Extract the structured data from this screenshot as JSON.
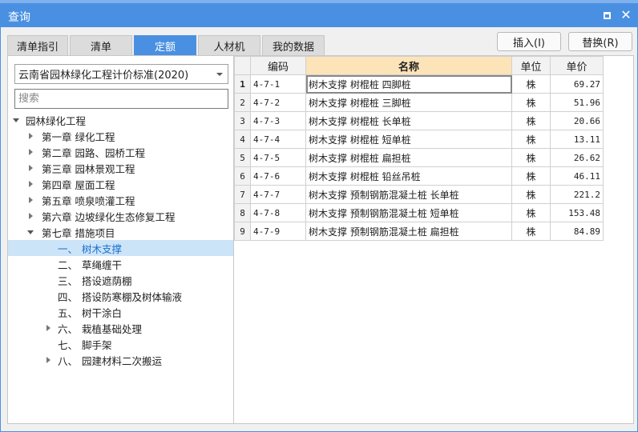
{
  "window": {
    "title": "查询"
  },
  "tabs": [
    {
      "label": "清单指引",
      "active": false
    },
    {
      "label": "清单",
      "active": false
    },
    {
      "label": "定额",
      "active": true
    },
    {
      "label": "人材机",
      "active": false
    },
    {
      "label": "我的数据",
      "active": false
    }
  ],
  "toolbar": {
    "insert_label": "插入(I)",
    "replace_label": "替换(R)"
  },
  "library": {
    "selected": "云南省园林绿化工程计价标准(2020)"
  },
  "search": {
    "placeholder": "搜索",
    "value": ""
  },
  "tree": [
    {
      "label": "园林绿化工程",
      "level": 0,
      "state": "expanded"
    },
    {
      "label": "第一章 绿化工程",
      "level": 1,
      "state": "collapsed"
    },
    {
      "label": "第二章 园路、园桥工程",
      "level": 1,
      "state": "collapsed"
    },
    {
      "label": "第三章 园林景观工程",
      "level": 1,
      "state": "collapsed"
    },
    {
      "label": "第四章 屋面工程",
      "level": 1,
      "state": "collapsed"
    },
    {
      "label": "第五章 喷泉喷灌工程",
      "level": 1,
      "state": "collapsed"
    },
    {
      "label": "第六章 边坡绿化生态修复工程",
      "level": 1,
      "state": "collapsed"
    },
    {
      "label": "第七章 措施项目",
      "level": 1,
      "state": "expanded"
    },
    {
      "num": "一、",
      "label": "树木支撑",
      "level": 2,
      "state": "leaf",
      "selected": true
    },
    {
      "num": "二、",
      "label": "草绳缠干",
      "level": 2,
      "state": "leaf"
    },
    {
      "num": "三、",
      "label": "搭设遮荫棚",
      "level": 2,
      "state": "leaf"
    },
    {
      "num": "四、",
      "label": "搭设防寒棚及树体输液",
      "level": 2,
      "state": "leaf"
    },
    {
      "num": "五、",
      "label": "树干涂白",
      "level": 2,
      "state": "leaf"
    },
    {
      "num": "六、",
      "label": "栽植基础处理",
      "level": 2,
      "state": "collapsed"
    },
    {
      "num": "七、",
      "label": "脚手架",
      "level": 2,
      "state": "leaf"
    },
    {
      "num": "八、",
      "label": "园建材料二次搬运",
      "level": 2,
      "state": "collapsed"
    }
  ],
  "grid": {
    "headers": {
      "code": "编码",
      "name": "名称",
      "unit": "单位",
      "price": "单价"
    },
    "rows": [
      {
        "n": "1",
        "code": "4-7-1",
        "name": "树木支撑 树棍桩 四脚桩",
        "unit": "株",
        "price": "69.27"
      },
      {
        "n": "2",
        "code": "4-7-2",
        "name": "树木支撑 树棍桩 三脚桩",
        "unit": "株",
        "price": "51.96"
      },
      {
        "n": "3",
        "code": "4-7-3",
        "name": "树木支撑 树棍桩 长单桩",
        "unit": "株",
        "price": "20.66"
      },
      {
        "n": "4",
        "code": "4-7-4",
        "name": "树木支撑 树棍桩 短单桩",
        "unit": "株",
        "price": "13.11"
      },
      {
        "n": "5",
        "code": "4-7-5",
        "name": "树木支撑 树棍桩 扁担桩",
        "unit": "株",
        "price": "26.62"
      },
      {
        "n": "6",
        "code": "4-7-6",
        "name": "树木支撑 树棍桩 铅丝吊桩",
        "unit": "株",
        "price": "46.11"
      },
      {
        "n": "7",
        "code": "4-7-7",
        "name": "树木支撑 预制钢筋混凝土桩 长单桩",
        "unit": "株",
        "price": "221.2"
      },
      {
        "n": "8",
        "code": "4-7-8",
        "name": "树木支撑 预制钢筋混凝土桩 短单桩",
        "unit": "株",
        "price": "153.48"
      },
      {
        "n": "9",
        "code": "4-7-9",
        "name": "树木支撑 预制钢筋混凝土桩 扁担桩",
        "unit": "株",
        "price": "84.89"
      }
    ]
  }
}
